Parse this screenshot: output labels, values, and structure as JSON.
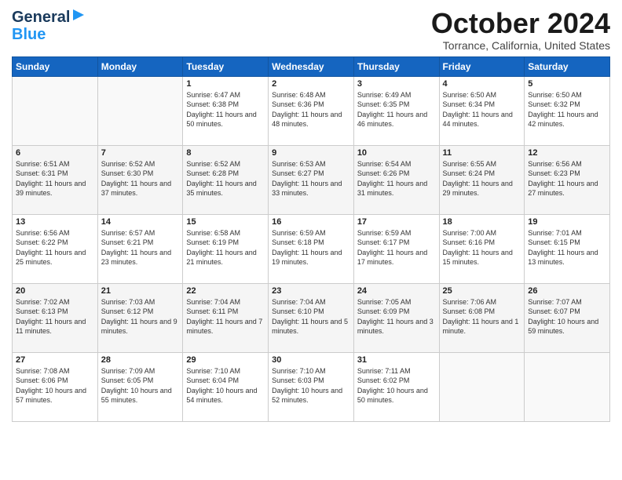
{
  "header": {
    "logo_general": "General",
    "logo_blue": "Blue",
    "month": "October 2024",
    "location": "Torrance, California, United States"
  },
  "weekdays": [
    "Sunday",
    "Monday",
    "Tuesday",
    "Wednesday",
    "Thursday",
    "Friday",
    "Saturday"
  ],
  "weeks": [
    [
      {
        "day": "",
        "info": ""
      },
      {
        "day": "",
        "info": ""
      },
      {
        "day": "1",
        "info": "Sunrise: 6:47 AM\nSunset: 6:38 PM\nDaylight: 11 hours and 50 minutes."
      },
      {
        "day": "2",
        "info": "Sunrise: 6:48 AM\nSunset: 6:36 PM\nDaylight: 11 hours and 48 minutes."
      },
      {
        "day": "3",
        "info": "Sunrise: 6:49 AM\nSunset: 6:35 PM\nDaylight: 11 hours and 46 minutes."
      },
      {
        "day": "4",
        "info": "Sunrise: 6:50 AM\nSunset: 6:34 PM\nDaylight: 11 hours and 44 minutes."
      },
      {
        "day": "5",
        "info": "Sunrise: 6:50 AM\nSunset: 6:32 PM\nDaylight: 11 hours and 42 minutes."
      }
    ],
    [
      {
        "day": "6",
        "info": "Sunrise: 6:51 AM\nSunset: 6:31 PM\nDaylight: 11 hours and 39 minutes."
      },
      {
        "day": "7",
        "info": "Sunrise: 6:52 AM\nSunset: 6:30 PM\nDaylight: 11 hours and 37 minutes."
      },
      {
        "day": "8",
        "info": "Sunrise: 6:52 AM\nSunset: 6:28 PM\nDaylight: 11 hours and 35 minutes."
      },
      {
        "day": "9",
        "info": "Sunrise: 6:53 AM\nSunset: 6:27 PM\nDaylight: 11 hours and 33 minutes."
      },
      {
        "day": "10",
        "info": "Sunrise: 6:54 AM\nSunset: 6:26 PM\nDaylight: 11 hours and 31 minutes."
      },
      {
        "day": "11",
        "info": "Sunrise: 6:55 AM\nSunset: 6:24 PM\nDaylight: 11 hours and 29 minutes."
      },
      {
        "day": "12",
        "info": "Sunrise: 6:56 AM\nSunset: 6:23 PM\nDaylight: 11 hours and 27 minutes."
      }
    ],
    [
      {
        "day": "13",
        "info": "Sunrise: 6:56 AM\nSunset: 6:22 PM\nDaylight: 11 hours and 25 minutes."
      },
      {
        "day": "14",
        "info": "Sunrise: 6:57 AM\nSunset: 6:21 PM\nDaylight: 11 hours and 23 minutes."
      },
      {
        "day": "15",
        "info": "Sunrise: 6:58 AM\nSunset: 6:19 PM\nDaylight: 11 hours and 21 minutes."
      },
      {
        "day": "16",
        "info": "Sunrise: 6:59 AM\nSunset: 6:18 PM\nDaylight: 11 hours and 19 minutes."
      },
      {
        "day": "17",
        "info": "Sunrise: 6:59 AM\nSunset: 6:17 PM\nDaylight: 11 hours and 17 minutes."
      },
      {
        "day": "18",
        "info": "Sunrise: 7:00 AM\nSunset: 6:16 PM\nDaylight: 11 hours and 15 minutes."
      },
      {
        "day": "19",
        "info": "Sunrise: 7:01 AM\nSunset: 6:15 PM\nDaylight: 11 hours and 13 minutes."
      }
    ],
    [
      {
        "day": "20",
        "info": "Sunrise: 7:02 AM\nSunset: 6:13 PM\nDaylight: 11 hours and 11 minutes."
      },
      {
        "day": "21",
        "info": "Sunrise: 7:03 AM\nSunset: 6:12 PM\nDaylight: 11 hours and 9 minutes."
      },
      {
        "day": "22",
        "info": "Sunrise: 7:04 AM\nSunset: 6:11 PM\nDaylight: 11 hours and 7 minutes."
      },
      {
        "day": "23",
        "info": "Sunrise: 7:04 AM\nSunset: 6:10 PM\nDaylight: 11 hours and 5 minutes."
      },
      {
        "day": "24",
        "info": "Sunrise: 7:05 AM\nSunset: 6:09 PM\nDaylight: 11 hours and 3 minutes."
      },
      {
        "day": "25",
        "info": "Sunrise: 7:06 AM\nSunset: 6:08 PM\nDaylight: 11 hours and 1 minute."
      },
      {
        "day": "26",
        "info": "Sunrise: 7:07 AM\nSunset: 6:07 PM\nDaylight: 10 hours and 59 minutes."
      }
    ],
    [
      {
        "day": "27",
        "info": "Sunrise: 7:08 AM\nSunset: 6:06 PM\nDaylight: 10 hours and 57 minutes."
      },
      {
        "day": "28",
        "info": "Sunrise: 7:09 AM\nSunset: 6:05 PM\nDaylight: 10 hours and 55 minutes."
      },
      {
        "day": "29",
        "info": "Sunrise: 7:10 AM\nSunset: 6:04 PM\nDaylight: 10 hours and 54 minutes."
      },
      {
        "day": "30",
        "info": "Sunrise: 7:10 AM\nSunset: 6:03 PM\nDaylight: 10 hours and 52 minutes."
      },
      {
        "day": "31",
        "info": "Sunrise: 7:11 AM\nSunset: 6:02 PM\nDaylight: 10 hours and 50 minutes."
      },
      {
        "day": "",
        "info": ""
      },
      {
        "day": "",
        "info": ""
      }
    ]
  ]
}
